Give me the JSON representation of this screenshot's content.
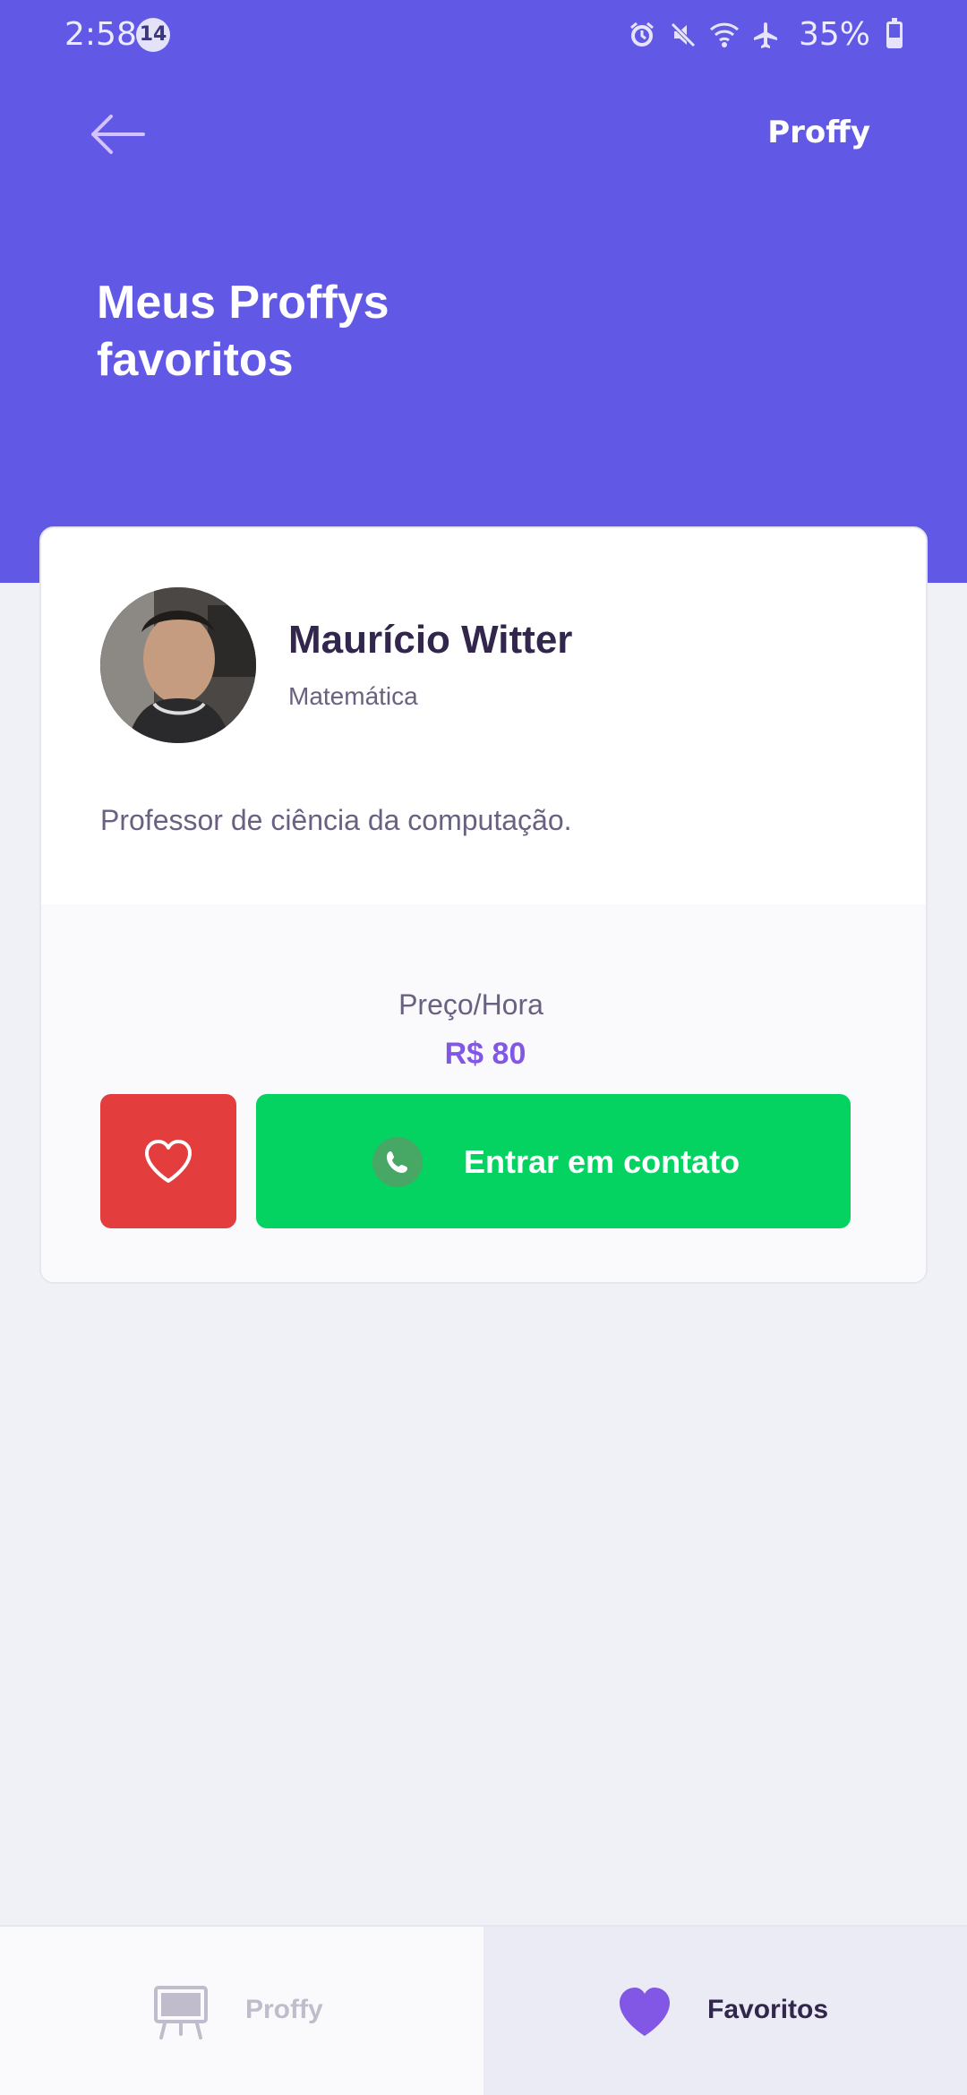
{
  "status_bar": {
    "time": "2:58",
    "notification_count": "14",
    "battery_percent": "35%",
    "icons": [
      "alarm-icon",
      "mute-icon",
      "wifi-icon",
      "airplane-icon",
      "battery-icon"
    ],
    "battery_level": 0.35
  },
  "header": {
    "brand": "Proffy",
    "title": "Meus Proffys favoritos",
    "background_color": "#6159E5"
  },
  "teacher": {
    "name": "Maurício Witter",
    "subject": "Matemática",
    "bio": "Professor de ciência da computação.",
    "price_label": "Preço/Hora",
    "price_value": "R$ 80",
    "contact_label": "Entrar em contato"
  },
  "bottom_nav": {
    "tabs": [
      {
        "label": "Proffy",
        "icon": "easel-icon",
        "active": false
      },
      {
        "label": "Favoritos",
        "icon": "heart-icon",
        "active": true
      }
    ]
  },
  "colors": {
    "primary": "#6159E5",
    "accent": "#8257E5",
    "favorite": "#E33D3D",
    "contact": "#04D361",
    "text_title": "#32264D",
    "text_base": "#6A6180"
  }
}
